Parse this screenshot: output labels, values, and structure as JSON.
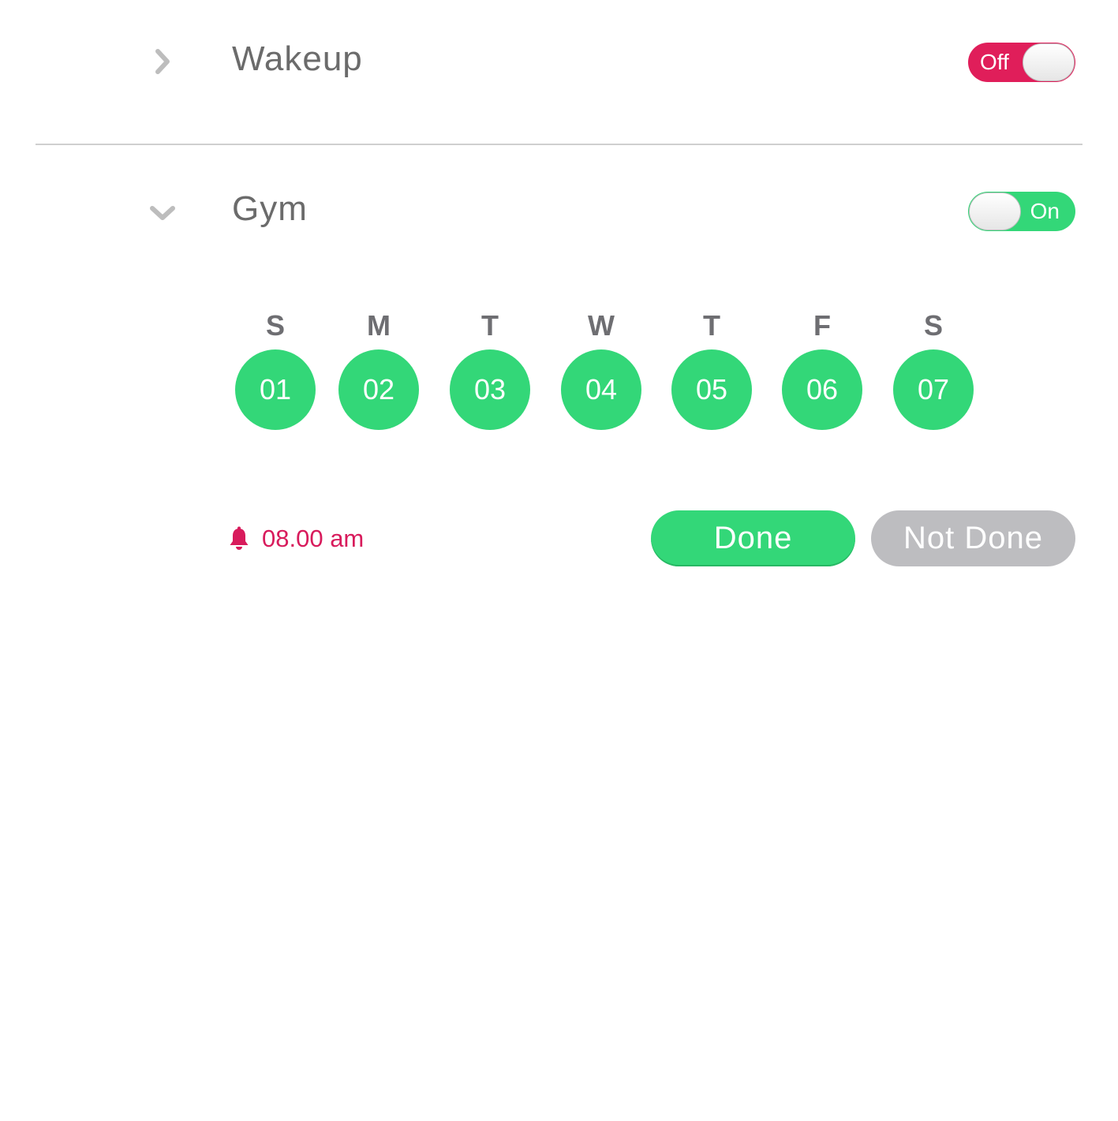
{
  "alarms": [
    {
      "title": "Wakeup",
      "expanded": false,
      "toggle": {
        "state": "off",
        "label": "Off"
      }
    },
    {
      "title": "Gym",
      "expanded": true,
      "toggle": {
        "state": "on",
        "label": "On"
      }
    }
  ],
  "days": [
    {
      "letter": "S",
      "number": "01"
    },
    {
      "letter": "M",
      "number": "02"
    },
    {
      "letter": "T",
      "number": "03"
    },
    {
      "letter": "W",
      "number": "04"
    },
    {
      "letter": "T",
      "number": "05"
    },
    {
      "letter": "F",
      "number": "06"
    },
    {
      "letter": "S",
      "number": "07"
    }
  ],
  "reminder": {
    "icon": "bell-icon",
    "time": "08.00 am"
  },
  "actions": {
    "done_label": "Done",
    "not_done_label": "Not Done"
  },
  "colors": {
    "accent_green": "#33d778",
    "accent_pink": "#e01e5a",
    "muted_gray": "#bdbdc0"
  }
}
